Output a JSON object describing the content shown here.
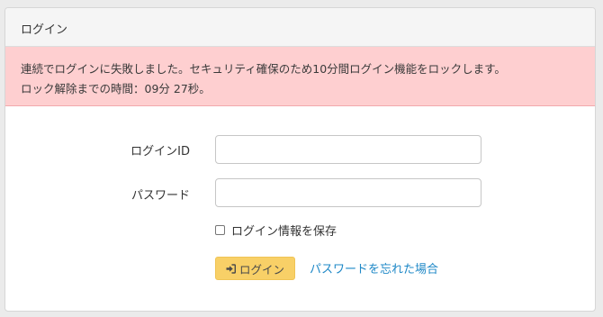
{
  "panel": {
    "title": "ログイン"
  },
  "alert": {
    "line1": "連続でログインに失敗しました。セキュリティ確保のため10分間ログイン機能をロックします。",
    "line2": "ロック解除までの時間：09分 27秒。"
  },
  "form": {
    "login_id_label": "ログインID",
    "login_id_value": "",
    "password_label": "パスワード",
    "password_value": "",
    "remember_label": "ログイン情報を保存",
    "remember_checked": false,
    "login_button_label": "ログイン",
    "login_button_icon": "sign-in-icon",
    "forgot_link_label": "パスワードを忘れた場合"
  },
  "colors": {
    "alert_bg": "#fecfd0",
    "button_bg": "#f8d067",
    "link": "#1e88c7"
  }
}
